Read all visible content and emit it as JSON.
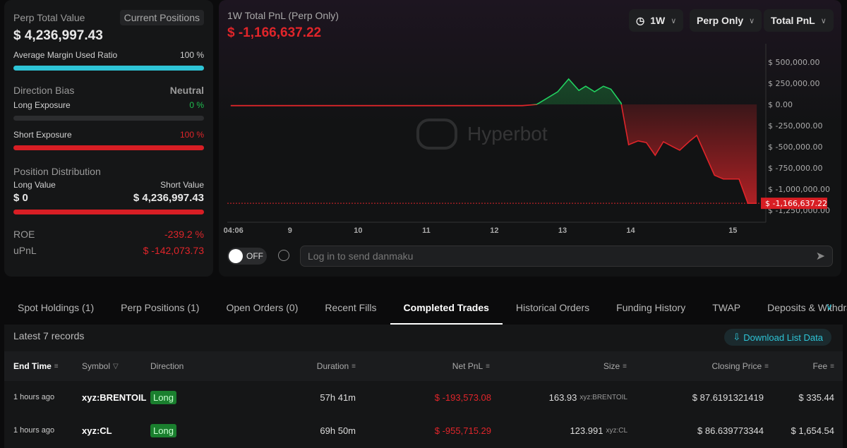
{
  "summary": {
    "title": "Perp Total Value",
    "current_positions": "Current Positions",
    "total_value": "$ 4,236,997.43",
    "margin_label": "Average Margin Used Ratio",
    "margin_value": "100 %",
    "margin_ratio": 1.0,
    "direction_label": "Direction Bias",
    "direction_value": "Neutral",
    "long_exposure_label": "Long Exposure",
    "long_exposure_value": "0 %",
    "long_exposure_ratio": 0,
    "short_exposure_label": "Short Exposure",
    "short_exposure_value": "100 %",
    "short_exposure_ratio": 1.0,
    "distribution_label": "Position Distribution",
    "long_value_label": "Long Value",
    "short_value_label": "Short Value",
    "long_value": "$ 0",
    "short_value": "$ 4,236,997.43",
    "roe_label": "ROE",
    "roe_value": "-239.2 %",
    "upnl_label": "uPnL",
    "upnl_value": "$ -142,073.73"
  },
  "chart": {
    "title": "1W Total PnL (Perp Only)",
    "value": "$ -1,166,637.22",
    "period": "1W",
    "scope": "Perp Only",
    "metric": "Total PnL",
    "watermark": "Hyperbot",
    "toggle": "OFF",
    "danmaku_placeholder": "Log in to send danmaku"
  },
  "chart_data": {
    "type": "line",
    "title": "1W Total PnL (Perp Only)",
    "x_ticks": [
      {
        "label": "04:06",
        "x": 8.17
      },
      {
        "label": "9",
        "x": 9
      },
      {
        "label": "10",
        "x": 10
      },
      {
        "label": "11",
        "x": 11
      },
      {
        "label": "12",
        "x": 12
      },
      {
        "label": "13",
        "x": 13
      },
      {
        "label": "14",
        "x": 14
      },
      {
        "label": "15",
        "x": 15.5
      }
    ],
    "y_ticks": [
      {
        "label": "$ 500,000.00",
        "v": 500000
      },
      {
        "label": "$ 250,000.00",
        "v": 250000
      },
      {
        "label": "$ 0.00",
        "v": 0
      },
      {
        "label": "$ -250,000.00",
        "v": -250000
      },
      {
        "label": "$ -500,000.00",
        "v": -500000
      },
      {
        "label": "$ -750,000.00",
        "v": -750000
      },
      {
        "label": "$ -1,000,000.00",
        "v": -1000000
      },
      {
        "label": "$ -1,250,000.00",
        "v": -1250000
      }
    ],
    "xlim": [
      8.08,
      15.88
    ],
    "ylim": [
      -1390000,
      733000
    ],
    "last_label": "$ -1,166,637.22",
    "last_value": -1166637.22,
    "points": [
      [
        8.13,
        -15000
      ],
      [
        12.41,
        -15000
      ],
      [
        12.62,
        0
      ],
      [
        12.93,
        150000
      ],
      [
        13.09,
        300000
      ],
      [
        13.24,
        165000
      ],
      [
        13.34,
        215000
      ],
      [
        13.47,
        150000
      ],
      [
        13.6,
        215000
      ],
      [
        13.71,
        180000
      ],
      [
        13.86,
        15000
      ],
      [
        13.97,
        -475000
      ],
      [
        14.11,
        -430000
      ],
      [
        14.23,
        -450000
      ],
      [
        14.36,
        -600000
      ],
      [
        14.48,
        -440000
      ],
      [
        14.62,
        -500000
      ],
      [
        14.72,
        -540000
      ],
      [
        14.87,
        -430000
      ],
      [
        14.97,
        -365000
      ],
      [
        15.23,
        -835000
      ],
      [
        15.36,
        -880000
      ],
      [
        15.59,
        -880000
      ],
      [
        15.72,
        -1166637
      ],
      [
        15.85,
        -1166637
      ]
    ]
  },
  "tabs": [
    "Spot Holdings (1)",
    "Perp Positions (1)",
    "Open Orders (0)",
    "Recent Fills",
    "Completed Trades",
    "Historical Orders",
    "Funding History",
    "TWAP",
    "Deposits & Withdraw"
  ],
  "records": "Latest 7 records",
  "download": "Download List Data",
  "columns": {
    "end_time": "End Time",
    "symbol": "Symbol",
    "direction": "Direction",
    "duration": "Duration",
    "net_pnl": "Net PnL",
    "size": "Size",
    "closing_price": "Closing Price",
    "fee": "Fee"
  },
  "rows": [
    {
      "end_time": "1 hours ago",
      "symbol": "xyz:BRENTOIL",
      "direction": "Long",
      "duration": "57h 41m",
      "net_pnl": "$ -193,573.08",
      "size": "163.93",
      "size_unit": "xyz:BRENTOIL",
      "closing_price": "$ 87.6191321419",
      "fee": "$ 335.44"
    },
    {
      "end_time": "1 hours ago",
      "symbol": "xyz:CL",
      "direction": "Long",
      "duration": "69h 50m",
      "net_pnl": "$ -955,715.29",
      "size": "123.991",
      "size_unit": "xyz:CL",
      "closing_price": "$ 86.639773344",
      "fee": "$ 1,654.54"
    }
  ]
}
